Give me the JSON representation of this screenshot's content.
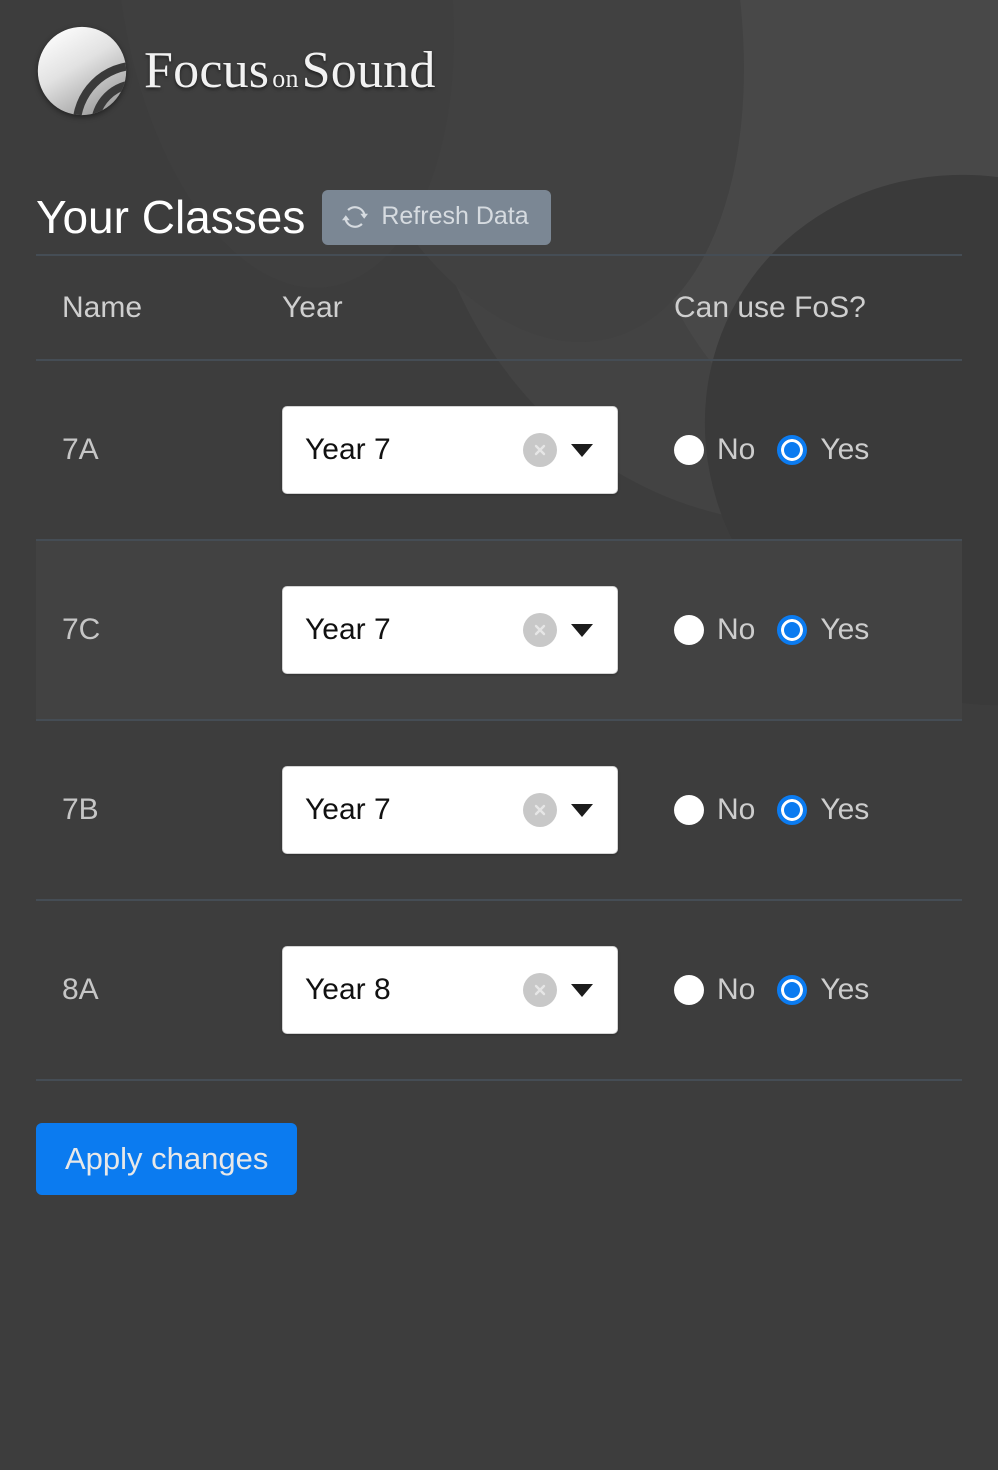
{
  "brand": {
    "logo_icon": "focus-on-sound-logo",
    "name_part1": "Focus",
    "name_part2": "on",
    "name_part3": "Sound"
  },
  "header": {
    "title": "Your Classes",
    "refresh_label": "Refresh Data",
    "refresh_icon": "refresh-icon",
    "refresh_bg": "#7b8794"
  },
  "table": {
    "columns": [
      "Name",
      "Year",
      "Can use FoS?"
    ],
    "rows": [
      {
        "name": "7A",
        "year": "Year 7",
        "clear_icon": "clear-circle-icon",
        "caret_icon": "chevron-down-icon",
        "options": [
          "No",
          "Yes"
        ],
        "selected": "Yes",
        "highlighted": false
      },
      {
        "name": "7C",
        "year": "Year 7",
        "clear_icon": "clear-circle-icon",
        "caret_icon": "chevron-down-icon",
        "options": [
          "No",
          "Yes"
        ],
        "selected": "Yes",
        "highlighted": true
      },
      {
        "name": "7B",
        "year": "Year 7",
        "clear_icon": "clear-circle-icon",
        "caret_icon": "chevron-down-icon",
        "options": [
          "No",
          "Yes"
        ],
        "selected": "Yes",
        "highlighted": false
      },
      {
        "name": "8A",
        "year": "Year 8",
        "clear_icon": "clear-circle-icon",
        "caret_icon": "chevron-down-icon",
        "options": [
          "No",
          "Yes"
        ],
        "selected": "Yes",
        "highlighted": false
      }
    ]
  },
  "footer": {
    "apply_label": "Apply changes",
    "apply_bg": "#0b7bf0"
  },
  "theme": {
    "page_bg": "#3d3d3d",
    "row_highlight_bg": "#424242",
    "divider": "#454d55",
    "accent_blue": "#0b7bf0",
    "text_primary": "#ffffff",
    "text_secondary": "#cdcdcd"
  }
}
